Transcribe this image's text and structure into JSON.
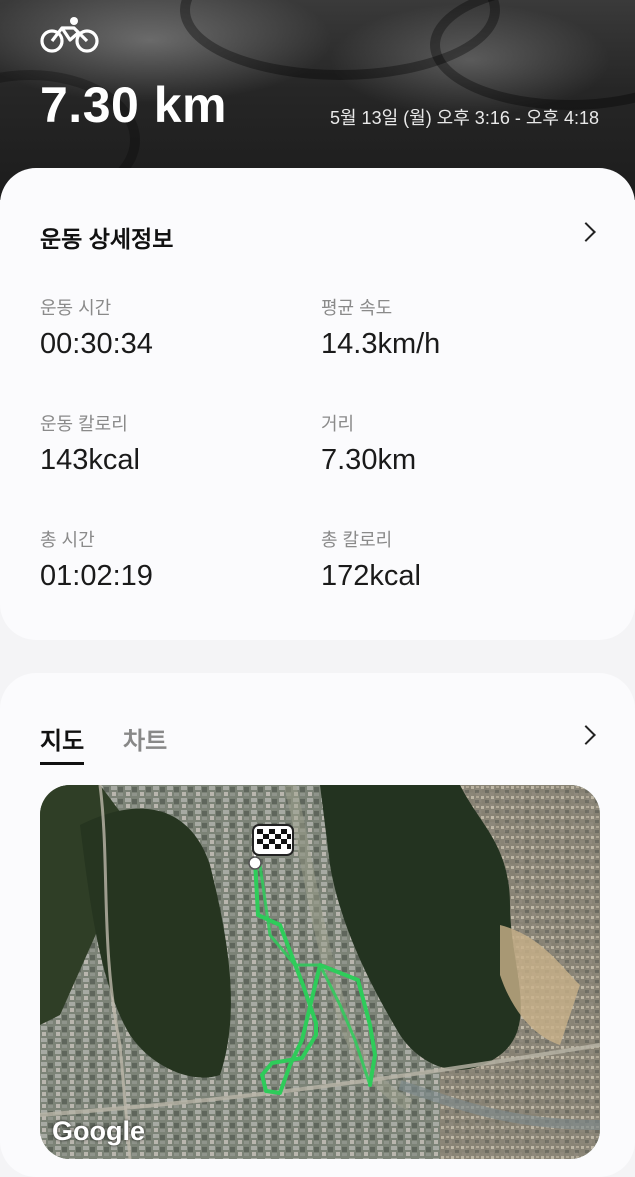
{
  "header": {
    "activity_icon": "bicycle-icon",
    "distance": "7.30 km",
    "date_range": "5월 13일 (월) 오후 3:16 - 오후 4:18"
  },
  "details": {
    "title": "운동 상세정보",
    "chevron_icon": "chevron-right-icon",
    "stats": [
      {
        "label": "운동 시간",
        "value": "00:30:34"
      },
      {
        "label": "평균 속도",
        "value": "14.3km/h"
      },
      {
        "label": "운동 칼로리",
        "value": "143kcal"
      },
      {
        "label": "거리",
        "value": "7.30km"
      },
      {
        "label": "총 시간",
        "value": "01:02:19"
      },
      {
        "label": "총 칼로리",
        "value": "172kcal"
      }
    ]
  },
  "map_card": {
    "tabs": [
      {
        "label": "지도",
        "active": true
      },
      {
        "label": "차트",
        "active": false
      }
    ],
    "chevron_icon": "chevron-right-icon",
    "map_attribution": "Google",
    "route_color": "#2ecc5a",
    "finish_icon": "checkered-flag-icon"
  }
}
